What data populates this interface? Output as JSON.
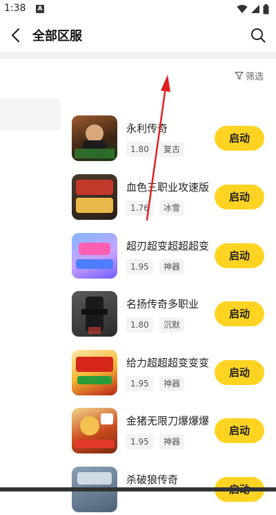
{
  "status_bar": {
    "time": "1:38",
    "notification_icon": "a-icon",
    "icons": [
      "wifi-icon",
      "signal-icon",
      "battery-icon"
    ]
  },
  "header": {
    "title": "全部区服",
    "back_icon": "chevron-left-icon",
    "search_icon": "search-icon"
  },
  "filter": {
    "label": "筛选",
    "icon": "filter-icon"
  },
  "games": [
    {
      "name": "永利传奇",
      "version": "1.80",
      "style": "复古",
      "button": "启动"
    },
    {
      "name": "血色三职业攻速版",
      "version": "1.76",
      "style": "冰雪",
      "button": "启动"
    },
    {
      "name": "超刃超变超超超变",
      "version": "1.95",
      "style": "神器",
      "button": "启动"
    },
    {
      "name": "名扬传奇多职业",
      "version": "1.80",
      "style": "沉默",
      "button": "启动"
    },
    {
      "name": "给力超超超变变变",
      "version": "1.95",
      "style": "神器",
      "button": "启动"
    },
    {
      "name": "金猪无限刀爆爆爆",
      "version": "1.95",
      "style": "神器",
      "button": "启动"
    },
    {
      "name": "杀破狼传奇",
      "version": "",
      "style": "",
      "button": "启动"
    }
  ],
  "colors": {
    "accent": "#ffd322",
    "annotation_arrow": "#e02020"
  }
}
